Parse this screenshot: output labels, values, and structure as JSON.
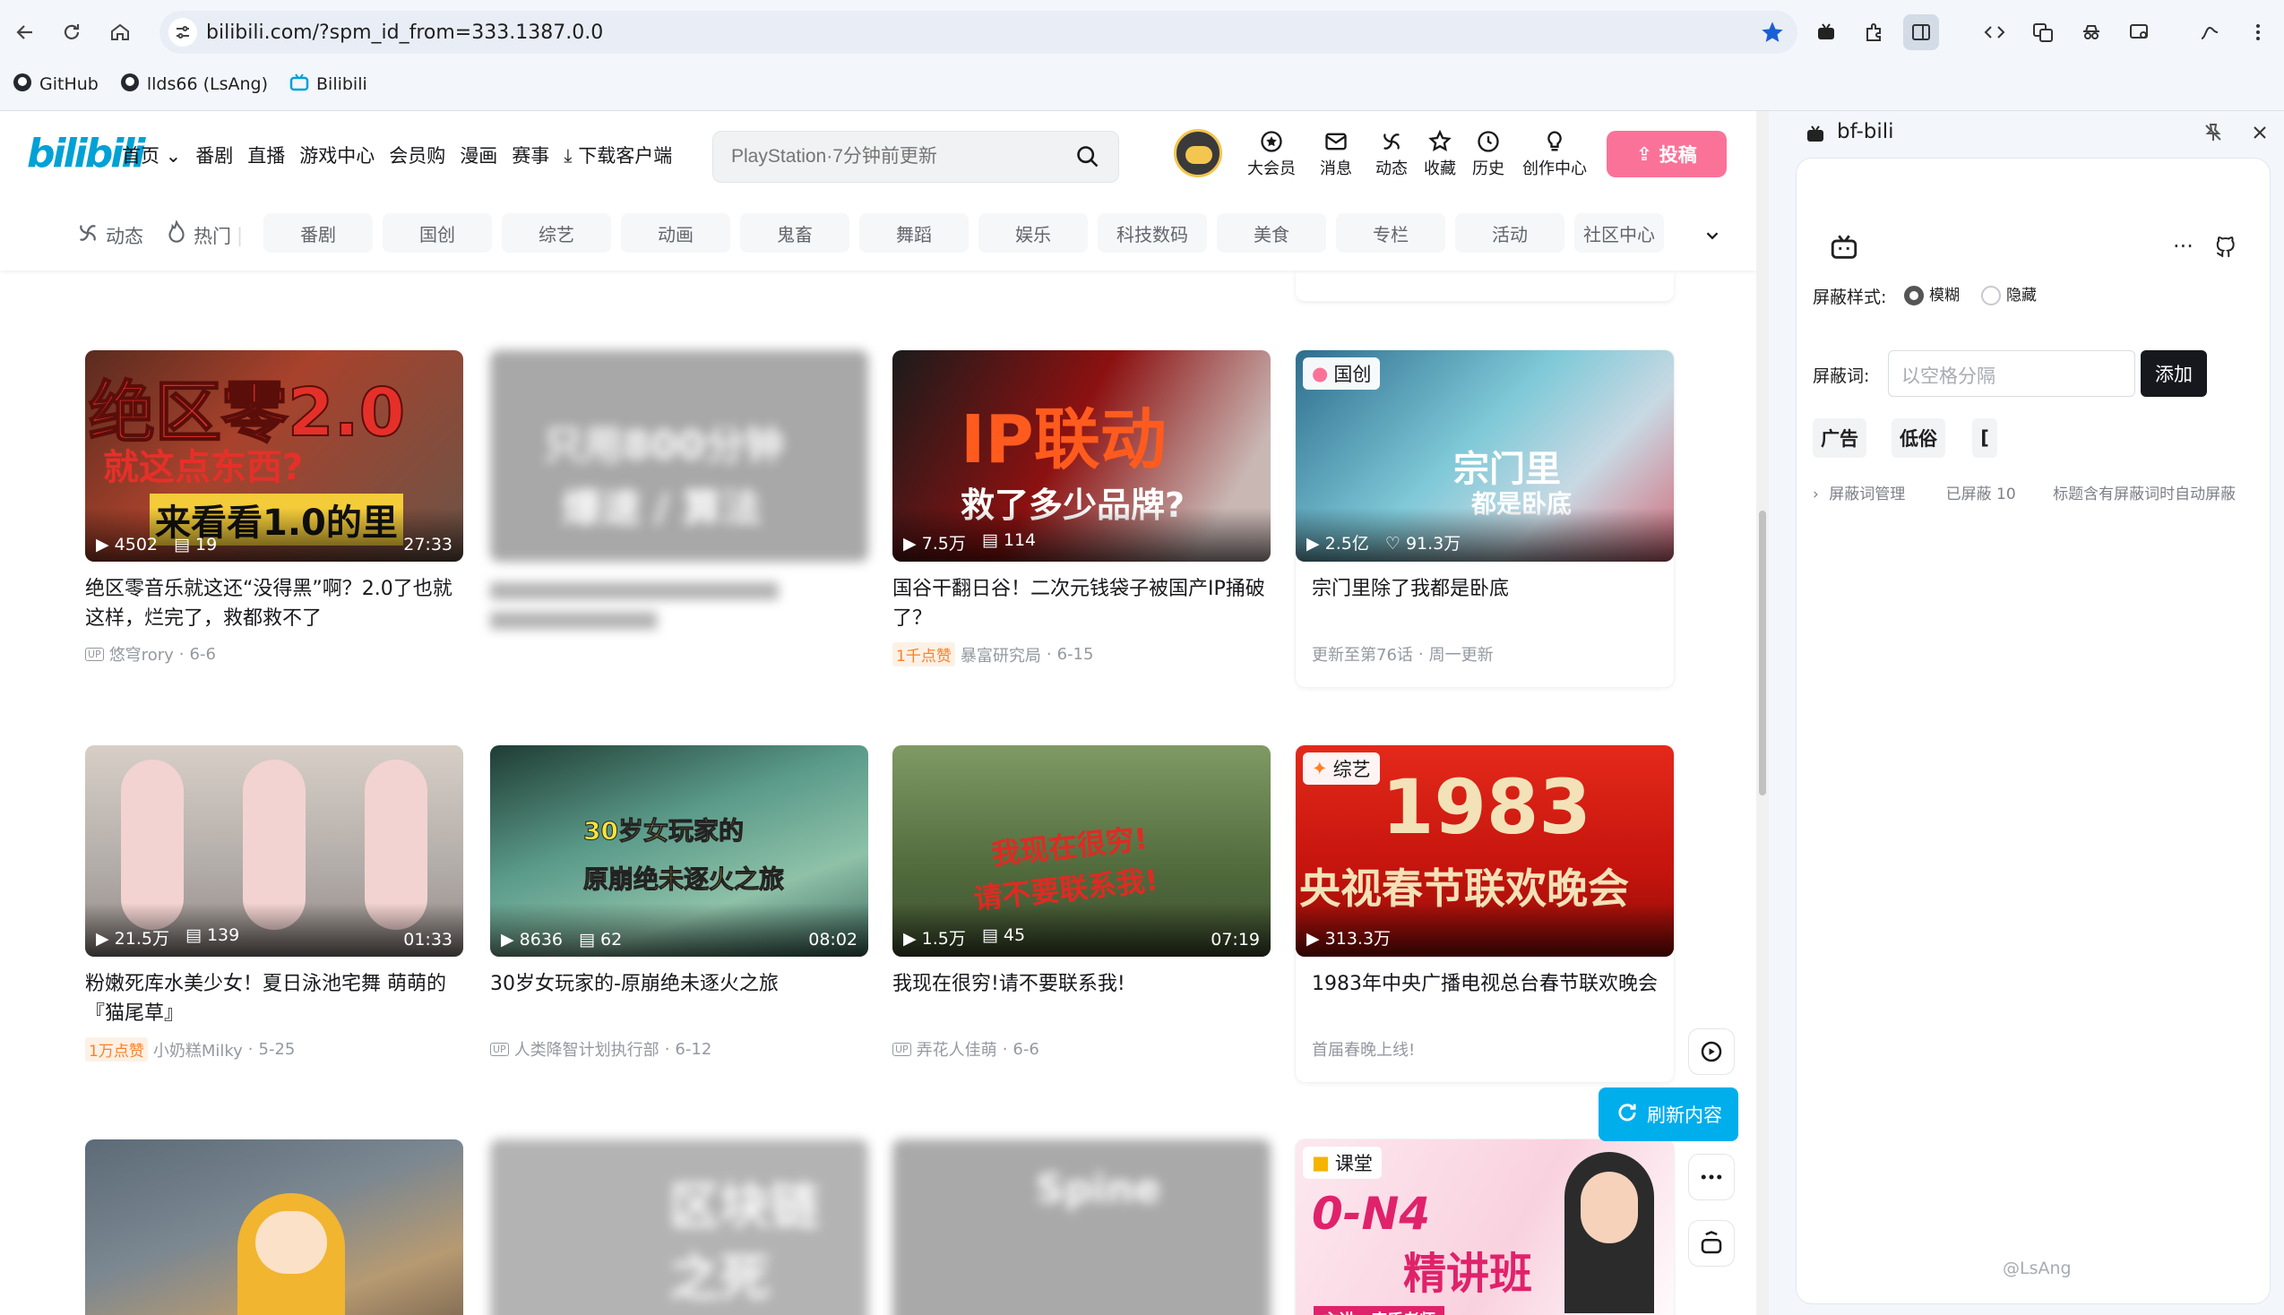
{
  "browser": {
    "url": "bilibili.com/?spm_id_from=333.1387.0.0",
    "bookmarks": [
      {
        "label": "GitHub"
      },
      {
        "label": "llds66 (LsAng)"
      },
      {
        "label": "Bilibili"
      }
    ]
  },
  "header": {
    "logo": "bilibili",
    "nav": [
      "首页",
      "番剧",
      "直播",
      "游戏中心",
      "会员购",
      "漫画",
      "赛事",
      "下载客户端"
    ],
    "search_placeholder": "PlayStation·7分钟前更新",
    "icons": [
      "大会员",
      "消息",
      "动态",
      "收藏",
      "历史",
      "创作中心"
    ],
    "upload": "投稿"
  },
  "channels": {
    "dynamic": "动态",
    "hot": "热门",
    "tags": [
      "番剧",
      "国创",
      "综艺",
      "动画",
      "鬼畜",
      "舞蹈",
      "娱乐",
      "科技数码",
      "美食",
      "专栏",
      "活动",
      "社区中心"
    ]
  },
  "cards": [
    {
      "title": "绝区零音乐就这还“没得黑”啊？2.0了也就这样，烂完了，救都救不了",
      "views": "4502",
      "danmaku": "19",
      "duration": "27:33",
      "author": "悠穹rory",
      "date": "6-6",
      "thumb_top": "绝区零2.0",
      "thumb_mid": "就这点东西?",
      "thumb_bot": "来看看1.0的里"
    },
    {
      "title": "",
      "views": "",
      "danmaku": "",
      "duration": "",
      "author": "",
      "date": "",
      "thumb_top": "只用800分钟",
      "thumb_mid": "爆速 / 算法"
    },
    {
      "title": "国谷干翻日谷！二次元钱袋子被国产IP捅破了？",
      "views": "7.5万",
      "danmaku": "114",
      "duration": "",
      "badge": "1千点赞",
      "author": "暴富研究局",
      "date": "6-15",
      "thumb_top": "IP联动",
      "thumb_mid": "救了多少品牌?"
    },
    {
      "title": "宗门里除了我都是卧底",
      "views": "2.5亿",
      "likes": "91.3万",
      "label": "国创",
      "update": "更新至第76话",
      "weekly": "周一更新",
      "thumb_top": "宗门里",
      "thumb_mid": "都是卧底"
    },
    {
      "title": "粉嫩死库水美少女！夏日泳池宅舞 萌萌的『猫尾草』",
      "views": "21.5万",
      "danmaku": "139",
      "duration": "01:33",
      "badge": "1万点赞",
      "author": "小奶糕Milky",
      "date": "5-25"
    },
    {
      "title": "30岁女玩家的-原崩绝未逐火之旅",
      "views": "8636",
      "danmaku": "62",
      "duration": "08:02",
      "author": "人类降智计划执行部",
      "date": "6-12",
      "thumb_top": "30岁女玩家的",
      "thumb_mid": "原崩绝未逐火之旅"
    },
    {
      "title": "我现在很穷!请不要联系我!",
      "views": "1.5万",
      "danmaku": "45",
      "duration": "07:19",
      "author": "弄花人佳萌",
      "date": "6-6",
      "thumb_top": "我现在很穷!",
      "thumb_mid": "请不要联系我!"
    },
    {
      "title": "1983年中央广播电视总台春节联欢晚会",
      "views": "313.3万",
      "label": "综艺",
      "desc": "首届春晚上线!",
      "thumb_top": "1983",
      "thumb_mid": "央视春节联欢晚会"
    },
    {
      "thumb": "row3-1"
    },
    {
      "thumb_top": "区块链",
      "thumb_mid": "之死"
    },
    {
      "thumb_top": "Spine"
    },
    {
      "label": "课堂",
      "thumb_top": "0-N4",
      "thumb_mid": "精讲班",
      "thumb_bot": "主讲：唐盾老师"
    }
  ],
  "side_controls": {
    "refresh": "刷新内容"
  },
  "panel": {
    "title": "bf-bili",
    "style_label": "屏蔽样式:",
    "style_options": [
      "模糊",
      "隐藏"
    ],
    "keyword_label": "屏蔽词:",
    "keyword_placeholder": "以空格分隔",
    "add_button": "添加",
    "keywords": [
      "广告",
      "低俗",
      "["
    ],
    "manage": "屏蔽词管理",
    "blocked_count": "已屏蔽 10",
    "hint": "标题含有屏蔽词时自动屏蔽",
    "footer": "@LsAng"
  }
}
